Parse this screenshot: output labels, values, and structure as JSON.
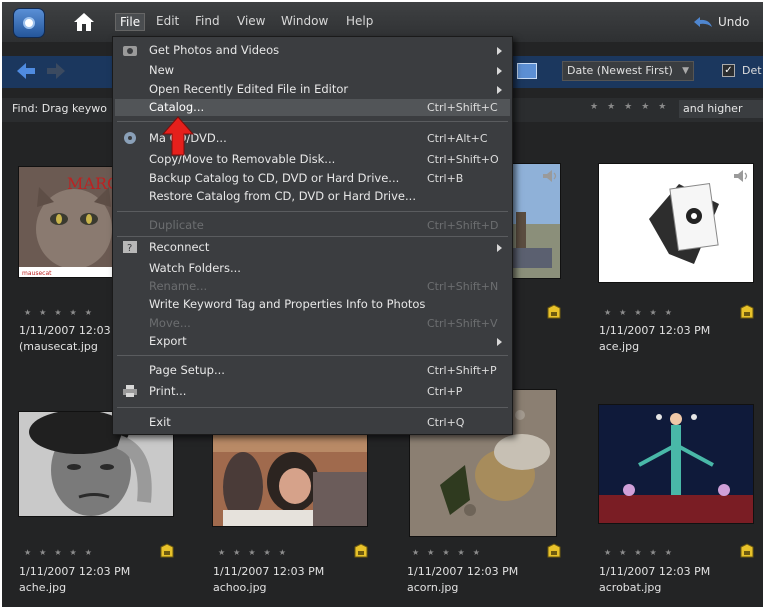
{
  "menubar": {
    "items": [
      "File",
      "Edit",
      "Find",
      "View",
      "Window",
      "Help"
    ],
    "undo_label": "Undo"
  },
  "toolbar": {
    "sort_value": "Date (Newest First)",
    "details_label": "Det",
    "details_checked": true
  },
  "findbar": {
    "find_text": "Find: Drag keywo",
    "rating_filter": "and higher"
  },
  "file_menu": {
    "items": [
      {
        "label": "Get Photos and Videos",
        "shortcut": "",
        "submenu": true,
        "disabled": false
      },
      {
        "label": "New",
        "shortcut": "",
        "submenu": true,
        "disabled": false
      },
      {
        "label": "Open Recently Edited File in Editor",
        "shortcut": "",
        "submenu": true,
        "disabled": false
      },
      {
        "label": "Catalog...",
        "shortcut": "Ctrl+Shift+C",
        "submenu": false,
        "disabled": false,
        "highlighted": true
      },
      {
        "label": "Ma    CD/DVD...",
        "shortcut": "Ctrl+Alt+C",
        "submenu": false,
        "disabled": false
      },
      {
        "label": "Copy/Move to Removable Disk...",
        "shortcut": "Ctrl+Shift+O",
        "submenu": false,
        "disabled": false
      },
      {
        "label": "Backup Catalog to CD, DVD or Hard Drive...",
        "shortcut": "Ctrl+B",
        "submenu": false,
        "disabled": false
      },
      {
        "label": "Restore Catalog from CD, DVD or Hard Drive...",
        "shortcut": "",
        "submenu": false,
        "disabled": false
      },
      {
        "label": "Duplicate",
        "shortcut": "Ctrl+Shift+D",
        "submenu": false,
        "disabled": true
      },
      {
        "label": "Reconnect",
        "shortcut": "",
        "submenu": true,
        "disabled": false
      },
      {
        "label": "Watch Folders...",
        "shortcut": "",
        "submenu": false,
        "disabled": false
      },
      {
        "label": "Rename...",
        "shortcut": "Ctrl+Shift+N",
        "submenu": false,
        "disabled": true
      },
      {
        "label": "Write Keyword Tag and Properties Info to Photos",
        "shortcut": "",
        "submenu": false,
        "disabled": false
      },
      {
        "label": "Move...",
        "shortcut": "Ctrl+Shift+V",
        "submenu": false,
        "disabled": true
      },
      {
        "label": "Export",
        "shortcut": "",
        "submenu": true,
        "disabled": false
      },
      {
        "label": "Page Setup...",
        "shortcut": "Ctrl+Shift+P",
        "submenu": false,
        "disabled": false
      },
      {
        "label": "Print...",
        "shortcut": "Ctrl+P",
        "submenu": false,
        "disabled": false
      },
      {
        "label": "Exit",
        "shortcut": "Ctrl+Q",
        "submenu": false,
        "disabled": false
      }
    ]
  },
  "thumbnails": [
    {
      "date": "1/11/2007 12:03",
      "name": "(mausecat.jpg",
      "logo_text": "MARC",
      "caption": "mausecat"
    },
    {
      "date": "1/11/2007 12:03 PM",
      "name": "ace.jpg"
    },
    {
      "date": "1/11/2007 12:03 PM",
      "name": "ache.jpg"
    },
    {
      "date": "1/11/2007 12:03 PM",
      "name": "achoo.jpg"
    },
    {
      "date": "1/11/2007 12:03 PM",
      "name": "acorn.jpg"
    },
    {
      "date": "1/11/2007 12:03 PM",
      "name": "acrobat.jpg"
    }
  ],
  "stars": "★★★★★",
  "colors": {
    "accent": "#1b375e",
    "highlight": "#525558",
    "annotation_arrow": "#e5201c"
  }
}
